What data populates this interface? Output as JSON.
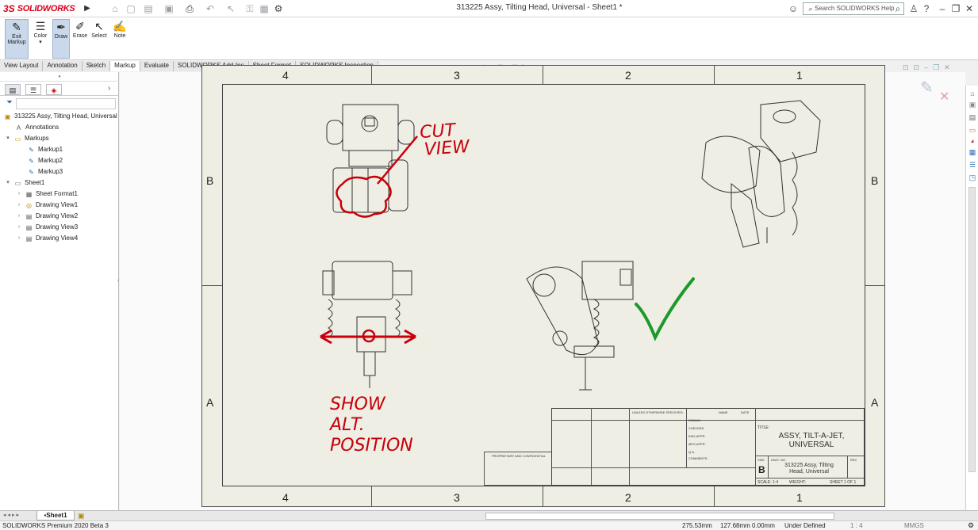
{
  "app": {
    "logo_ds": "3S",
    "logo_name": "SOLIDWORKS",
    "document_title": "313225 Assy, Tilting Head, Universal - Sheet1 *",
    "search_placeholder": "Search SOLIDWORKS Help"
  },
  "command_manager": {
    "exit_markup": "Exit Markup",
    "color": "Color",
    "draw": "Draw",
    "erase": "Erase",
    "select": "Select",
    "note": "Note"
  },
  "tabs": [
    "View Layout",
    "Annotation",
    "Sketch",
    "Markup",
    "Evaluate",
    "SOLIDWORKS Add-Ins",
    "Sheet Format",
    "SOLIDWORKS Inspection"
  ],
  "selected_tab": "Markup",
  "tree": {
    "root": "313225 Assy, Tilting Head, Universal",
    "annotations": "Annotations",
    "markups": "Markups",
    "markup_items": [
      "Markup1",
      "Markup2",
      "Markup3"
    ],
    "sheet": "Sheet1",
    "sheet_items": [
      "Sheet Format1",
      "Drawing View1",
      "Drawing View2",
      "Drawing View3",
      "Drawing View4"
    ]
  },
  "sheet": {
    "zone_columns": [
      "4",
      "3",
      "2",
      "1"
    ],
    "zone_rows": [
      "B",
      "A"
    ]
  },
  "markup_notes": {
    "cut_view_1": "CUT",
    "cut_view_2": "VIEW",
    "show_1": "SHOW",
    "show_2": "ALT.",
    "show_3": "POSITION"
  },
  "title_block": {
    "title_label": "TITLE:",
    "title_1": "ASSY, TILT-A-JET,",
    "title_2": "UNIVERSAL",
    "size_label": "SIZE",
    "size": "B",
    "dwg_no_label": "DWG. NO.",
    "dwg_no_1": "313225 Assy, Tilting",
    "dwg_no_2": "Head, Universal",
    "rev_label": "REV",
    "scale": "SCALE: 1:4",
    "weight": "WEIGHT:",
    "sheet": "SHEET 1 OF 1",
    "unless": "UNLESS OTHERWISE SPECIFIED:",
    "name": "NAME",
    "date": "DATE",
    "drawn": "DRAWN",
    "checked": "CHECKED",
    "eng_appr": "ENG APPR.",
    "mfg_appr": "MFG APPR.",
    "qa": "Q.A.",
    "comments": "COMMENTS:",
    "proprietary": "PROPRIETARY AND CONFIDENTIAL"
  },
  "bottom": {
    "sheet_tab": "Sheet1"
  },
  "status": {
    "product": "SOLIDWORKS Premium 2020 Beta 3",
    "x": "275.53mm",
    "y": "127.68mm",
    "z": "0.00mm",
    "state": "Under Defined",
    "scale": "1 : 4",
    "units": "MMGS"
  },
  "colors": {
    "brand": "#d6001c",
    "markup_red": "#c8000a",
    "markup_green": "#1a9a2a"
  }
}
